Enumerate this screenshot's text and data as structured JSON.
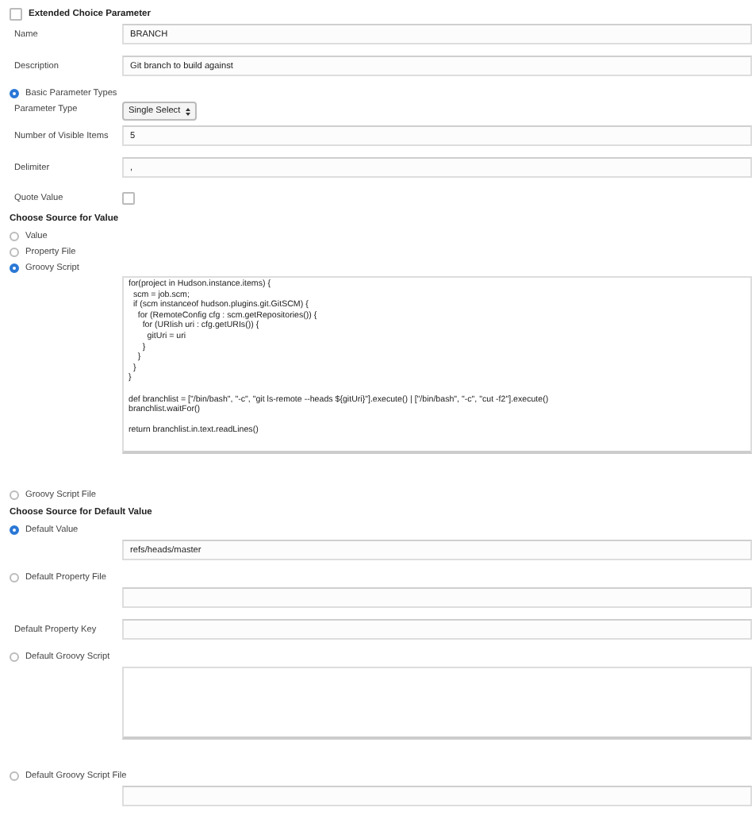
{
  "rows": [
    {
      "kind": "header",
      "label": "Extended Choice Parameter",
      "checked": false
    },
    {
      "kind": "text",
      "label": "Name",
      "value": "BRANCH"
    },
    {
      "kind": "text",
      "label": "Description",
      "value": "Git branch to build against"
    },
    {
      "kind": "radio",
      "label": "Basic Parameter Types",
      "selected": true
    },
    {
      "kind": "select",
      "label": "Parameter Type",
      "value": "Single Select"
    },
    {
      "kind": "text",
      "label": "Number of Visible Items",
      "value": "5"
    },
    {
      "kind": "text",
      "label": "Delimiter",
      "value": ","
    },
    {
      "kind": "checkbox",
      "label": "Quote Value",
      "checked": false
    },
    {
      "kind": "heading",
      "label": "Choose Source for Value"
    },
    {
      "kind": "radio",
      "label": "Value",
      "selected": false
    },
    {
      "kind": "radio",
      "label": "Property File",
      "selected": false
    },
    {
      "kind": "radio",
      "label": "Groovy Script",
      "selected": true
    },
    {
      "kind": "code",
      "value": "for(project in Hudson.instance.items) {\n  scm = job.scm;\n  if (scm instanceof hudson.plugins.git.GitSCM) {\n    for (RemoteConfig cfg : scm.getRepositories()) {\n      for (URIish uri : cfg.getURIs()) {\n        gitUri = uri\n      }\n    }\n  }\n}\n\ndef branchlist = [\"/bin/bash\", \"-c\", \"git ls-remote --heads ${gitUri}\"].execute() | [\"/bin/bash\", \"-c\", \"cut -f2\"].execute()\nbranchlist.waitFor()\n\nreturn branchlist.in.text.readLines()"
    },
    {
      "kind": "radio",
      "label": "Groovy Script File",
      "selected": false
    },
    {
      "kind": "heading",
      "label": "Choose Source for Default Value"
    },
    {
      "kind": "radio",
      "label": "Default Value",
      "selected": true
    },
    {
      "kind": "text",
      "value": "refs/heads/master"
    },
    {
      "kind": "radio",
      "label": "Default Property File",
      "selected": false
    },
    {
      "kind": "text"
    },
    {
      "kind": "text",
      "label": "Default Property Key"
    },
    {
      "kind": "radio",
      "label": "Default Groovy Script",
      "selected": false
    },
    {
      "kind": "textarea"
    },
    {
      "kind": "radio",
      "label": "Default Groovy Script File",
      "selected": false
    },
    {
      "kind": "text"
    }
  ]
}
